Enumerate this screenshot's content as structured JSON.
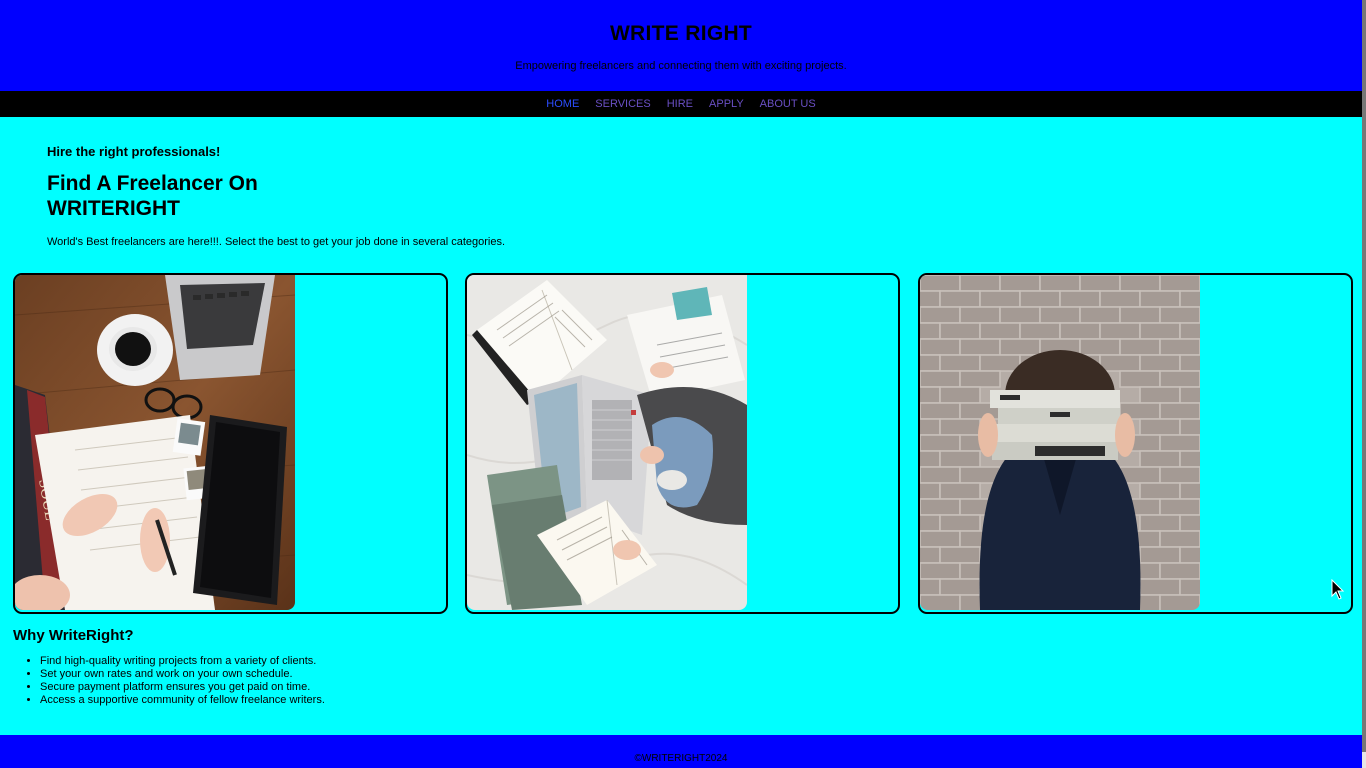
{
  "header": {
    "title": "WRITE RIGHT",
    "tagline": "Empowering freelancers and connecting them with exciting projects."
  },
  "nav": {
    "items": [
      {
        "label": "HOME",
        "active": true
      },
      {
        "label": "SERVICES",
        "active": false
      },
      {
        "label": "HIRE",
        "active": false
      },
      {
        "label": "APPLY",
        "active": false
      },
      {
        "label": "ABOUT US",
        "active": false
      }
    ]
  },
  "hero": {
    "kicker": "Hire the right professionals!",
    "title": "Find A Freelancer On WRITERIGHT",
    "description": "World's Best freelancers are here!!!. Select the best to get your job done in several categories."
  },
  "cards": [
    {
      "photo": "desk-laptop-coffee-writing-photo"
    },
    {
      "photo": "bed-laptop-books-photo"
    },
    {
      "photo": "person-holding-books-brick-wall-photo"
    }
  ],
  "why": {
    "title": "Why WriteRight?",
    "items": [
      "Find high-quality writing projects from a variety of clients.",
      "Set your own rates and work on your own schedule.",
      "Secure payment platform ensures you get paid on time.",
      "Access a supportive community of fellow freelance writers."
    ]
  },
  "footer": {
    "copyright": "©WRITERIGHT2024"
  },
  "colors": {
    "header_bg": "#0000ff",
    "page_bg": "#00ffff",
    "nav_bg": "#000000",
    "nav_link": "#6a4fc4",
    "nav_active": "#2c4dff"
  }
}
